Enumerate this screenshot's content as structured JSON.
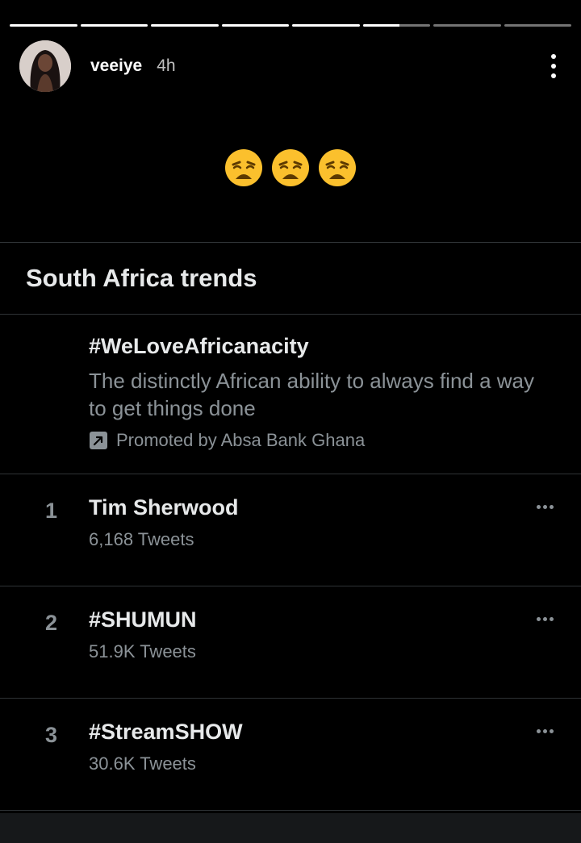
{
  "story": {
    "segments": [
      1,
      1,
      1,
      1,
      1,
      0.55,
      0,
      0
    ],
    "username": "veeiye",
    "time": "4h"
  },
  "emojis": [
    "weary-face",
    "weary-face",
    "weary-face"
  ],
  "trends_card": {
    "title": "South Africa trends",
    "promoted": {
      "hashtag": "#WeLoveAfricanacity",
      "description": "The distinctly African ability to always find a way to get things done",
      "promoted_by": "Promoted by Absa Bank Ghana"
    },
    "trends": [
      {
        "rank": "1",
        "name": "Tim Sherwood",
        "count": "6,168 Tweets"
      },
      {
        "rank": "2",
        "name": "#SHUMUN",
        "count": "51.9K Tweets"
      },
      {
        "rank": "3",
        "name": "#StreamSHOW",
        "count": "30.6K Tweets"
      }
    ]
  },
  "colors": {
    "background": "#000000",
    "primary_text": "#e7e9ea",
    "secondary_text": "#8b9297",
    "divider": "#2f3336",
    "emoji_face": "#fbc02d"
  }
}
